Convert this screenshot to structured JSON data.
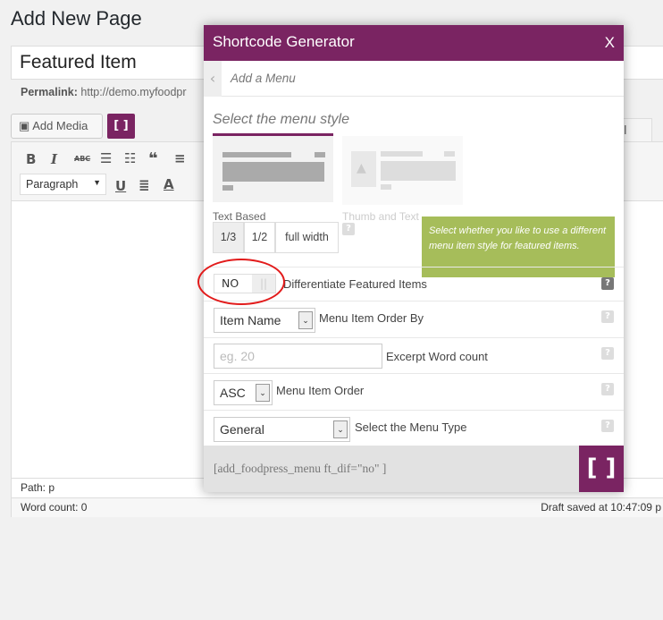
{
  "page": {
    "title": "Add New Page",
    "post_title": "Featured Item",
    "permalink_label": "Permalink:",
    "permalink": "http://demo.myfoodpr",
    "add_media": "Add Media",
    "shortcode_button": "[ ]",
    "format": "Paragraph",
    "tab_visual": "sual",
    "path": "Path: p",
    "word_count": "Word count: 0",
    "draft_saved": "Draft saved at 10:47:09 p"
  },
  "toolbar": {
    "bold": "B",
    "italic": "I",
    "strike": "ABC",
    "ul": "☰",
    "ol": "☷",
    "quote": "❝",
    "align": "≡",
    "underline": "U",
    "justify": "≣",
    "color": "A"
  },
  "modal": {
    "title": "Shortcode Generator",
    "close": "X",
    "subtitle": "Add a Menu",
    "select_style": "Select the menu style",
    "styles": [
      {
        "label": "Text Based",
        "selected": true
      },
      {
        "label": "Thumb and Text",
        "selected": false
      }
    ],
    "widths": [
      "1/3",
      "1/2",
      "full width"
    ],
    "tooltip": "Select whether you like to use a different menu item style for featured items.",
    "toggle": {
      "value": "NO",
      "label": "Differentiate Featured Items"
    },
    "order_by": {
      "value": "Item Name",
      "label": "Menu Item Order By"
    },
    "excerpt": {
      "placeholder": "eg. 20",
      "label": "Excerpt Word count"
    },
    "order": {
      "value": "ASC",
      "label": "Menu Item Order"
    },
    "menu_type": {
      "value": "General",
      "label": "Select the Menu Type"
    },
    "shortcode": "[add_foodpress_menu ft_dif=\"no\" ]",
    "generate": "[ ]",
    "help": "?"
  },
  "colors": {
    "brand": "#7a2462",
    "tooltip": "#a6bd5a",
    "annotation": "#e21b1b"
  }
}
